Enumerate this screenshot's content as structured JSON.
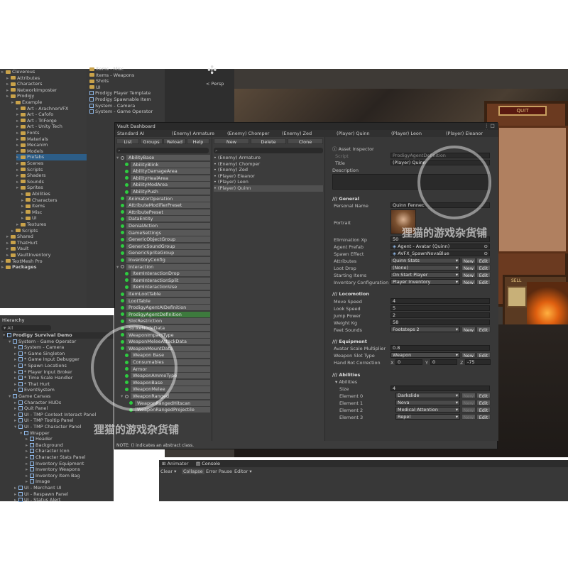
{
  "project_tree": [
    "Cleverous",
    "Attributes",
    "Characters",
    "NetworkImposter",
    "Prodigy",
    "Example",
    "Art - ArachnorVFX",
    "Art - Cafofo",
    "Art - TriForge",
    "Art - Unity Tech",
    "Fonts",
    "Materials",
    "Mecanim",
    "Models",
    "Prefabs",
    "Scenes",
    "Scripts",
    "Shaders",
    "Sounds",
    "Sprites",
    "Abilities",
    "Characters",
    "Items",
    "Misc",
    "UI",
    "Textures",
    "Scripts",
    "Shared",
    "ThatHurt",
    "Vault",
    "VaultInventory",
    "TextMesh Pro",
    "Packages"
  ],
  "assets_list": [
    "Items - Misc",
    "Items - Weapons",
    "Shots",
    "UI",
    "Prodigy Player Template",
    "Prodigy Spawnable Item",
    "System - Camera",
    "System - Game Operator"
  ],
  "scene": {
    "persp": "< Persp",
    "quit": "QUIT",
    "sell": "SELL"
  },
  "hierarchy": {
    "tab": "Hierarchy",
    "search": "All",
    "items": [
      "Prodigy Survival Demo",
      "System - Game Operator",
      "System - Camera",
      "* Game Singleton",
      "* Game Input Debugger",
      "* Spawn Locations",
      "* Player Input Broker",
      "* Time Scale Handler",
      "* That Hurt",
      "EventSystem",
      "Game Canvas",
      "Character HUDs",
      "Quit Panel",
      "UI - TMP Context Interact Panel",
      "UI - TMP Tooltip Panel",
      "UI - TMP Character Panel",
      "Wrapper",
      "Header",
      "Background",
      "Character Icon",
      "Character Stats Panel",
      "Inventory Equipment",
      "Inventory Weapons",
      "Inventory Item Bag",
      "Image",
      "UI - Merchant UI",
      "UI - Respawn Panel",
      "UI - Status Alert"
    ]
  },
  "vault": {
    "title": "Vault Dashboard",
    "tabs": [
      "Standard AI",
      "(Enemy) Armature",
      "(Enemy) Chomper",
      "(Enemy) Zed",
      "(Player) Quinn",
      "(Player) Leon",
      "(Player) Eleanor"
    ],
    "left_buttons": [
      "List",
      "Groups",
      "Reload",
      "Help"
    ],
    "mid_buttons": [
      "New",
      "Delete",
      "Clone"
    ],
    "types": [
      "AbilityBase",
      "AbilityBlink",
      "AbilityDamageArea",
      "AbilityHealArea",
      "AbilityModArea",
      "AbilityPush",
      "AnimatorOperation",
      "AttributeModifierPreset",
      "AttributePreset",
      "DataEntity",
      "DenialAction",
      "GameSettings",
      "GenericObjectGroup",
      "GenericSoundGroup",
      "GenericSpriteGroup",
      "InventoryConfig",
      "Interaction",
      "ItemInteractionDrop",
      "ItemInteractionSplit",
      "ItemInteractionUse",
      "ItemLootTable",
      "LootTable",
      "ProdigyAgentAIDefinition",
      "ProdigyAgentDefinition",
      "SlotRestriction",
      "StrikeNodeData",
      "WeaponImpactType",
      "WeaponMeleeAttackData",
      "WeaponMountData",
      "Weapon Base",
      "Consumables",
      "Armor",
      "WeaponAmmoType",
      "WeaponBase",
      "WeaponMelee",
      "WeaponRanged",
      "WeaponRangedHitscan",
      "WeaponRangedProjectile"
    ],
    "entities": [
      "(Enemy) Armature",
      "(Enemy) Chomper",
      "(Enemy) Zed",
      "(Player) Eleanor",
      "(Player) Leon",
      "(Player) Quinn"
    ],
    "note": "NOTE: () indicates an abstract class."
  },
  "inspector": {
    "asset_inspector": "Asset Inspector",
    "script_label": "Script",
    "script_value": "ProdigyAgentDefinition",
    "title_label": "Title",
    "title_value": "(Player) Quinn",
    "description_label": "Description",
    "general": "/// General",
    "personal_name_label": "Personal Name",
    "personal_name_value": "Quinn Fennec",
    "portrait_label": "Portrait",
    "elimination_label": "Elimination Xp",
    "elimination_value": "50",
    "agent_prefab_label": "Agent Prefab",
    "agent_prefab_value": "Agent - Avatar (Quinn)",
    "spawn_effect_label": "Spawn Effect",
    "spawn_effect_value": "AVFX_SpawnNovaBlue",
    "attributes_label": "Attributes",
    "attributes_value": "Quinn Stats",
    "loot_drop_label": "Loot Drop",
    "loot_drop_value": "(None)",
    "starting_items_label": "Starting Items",
    "starting_items_value": "On Start Player",
    "inv_config_label": "Inventory Configuration",
    "inv_config_value": "Player Inventory",
    "btn_new": "New",
    "btn_edit": "Edit",
    "locomotion": "/// Locomotion",
    "move_speed_label": "Move Speed",
    "move_speed_value": "4",
    "look_speed_label": "Look Speed",
    "look_speed_value": "5",
    "jump_power_label": "Jump Power",
    "jump_power_value": "2",
    "weight_label": "Weight Kg",
    "weight_value": "58",
    "feet_sounds_label": "Feet Sounds",
    "feet_sounds_value": "Footsteps 2",
    "equipment": "/// Equipment",
    "avatar_scale_label": "Avatar Scale Multiplier",
    "avatar_scale_value": "0.8",
    "weapon_slot_label": "Weapon Slot Type",
    "weapon_slot_value": "Weapon",
    "hand_rot_label": "Hand Rot Correction",
    "x": "X",
    "x_value": "0",
    "y": "Y",
    "y_value": "0",
    "z": "Z",
    "z_value": "-75",
    "abilities": "/// Abilities",
    "abilities_fold": "Abilities",
    "size_label": "Size",
    "size_value": "4",
    "elements": [
      {
        "label": "Element 0",
        "value": "Darkslide"
      },
      {
        "label": "Element 1",
        "value": "Nova"
      },
      {
        "label": "Element 2",
        "value": "Medical Attention"
      },
      {
        "label": "Element 3",
        "value": "Repel"
      }
    ]
  },
  "console": {
    "tabs": [
      "Animator",
      "Console"
    ],
    "buttons": [
      "Clear",
      "Collapse",
      "Error Pause",
      "Editor"
    ]
  },
  "watermark": "狸猫的游戏杂货铺"
}
